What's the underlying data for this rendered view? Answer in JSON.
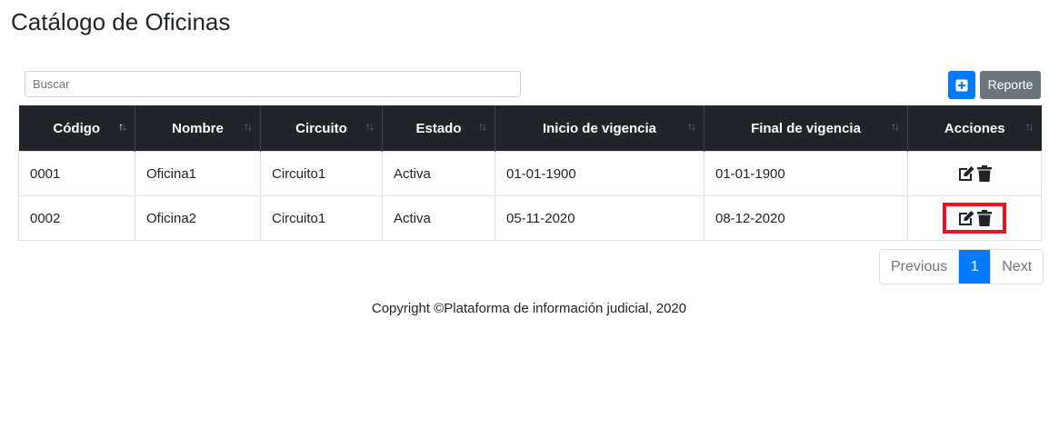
{
  "page": {
    "title": "Catálogo de Oficinas"
  },
  "toolbar": {
    "search_placeholder": "Buscar",
    "search_value": "",
    "add_icon": "plus-square-icon",
    "report_label": "Reporte"
  },
  "table": {
    "columns": [
      "Código",
      "Nombre",
      "Circuito",
      "Estado",
      "Inicio de vigencia",
      "Final de vigencia",
      "Acciones"
    ],
    "rows": [
      {
        "codigo": "0001",
        "nombre": "Oficina1",
        "circuito": "Circuito1",
        "estado": "Activa",
        "inicio": "01-01-1900",
        "final": "01-01-1900"
      },
      {
        "codigo": "0002",
        "nombre": "Oficina2",
        "circuito": "Circuito1",
        "estado": "Activa",
        "inicio": "05-11-2020",
        "final": "08-12-2020"
      }
    ],
    "action_icons": [
      "edit-icon",
      "trash-icon"
    ]
  },
  "pagination": {
    "previous": "Previous",
    "current": "1",
    "next": "Next"
  },
  "footer": {
    "text": "Copyright ©Plataforma de información judicial, 2020"
  },
  "colors": {
    "primary": "#007bff",
    "secondary": "#6c757d",
    "header_dark": "#212529",
    "highlight": "#e8151f"
  }
}
